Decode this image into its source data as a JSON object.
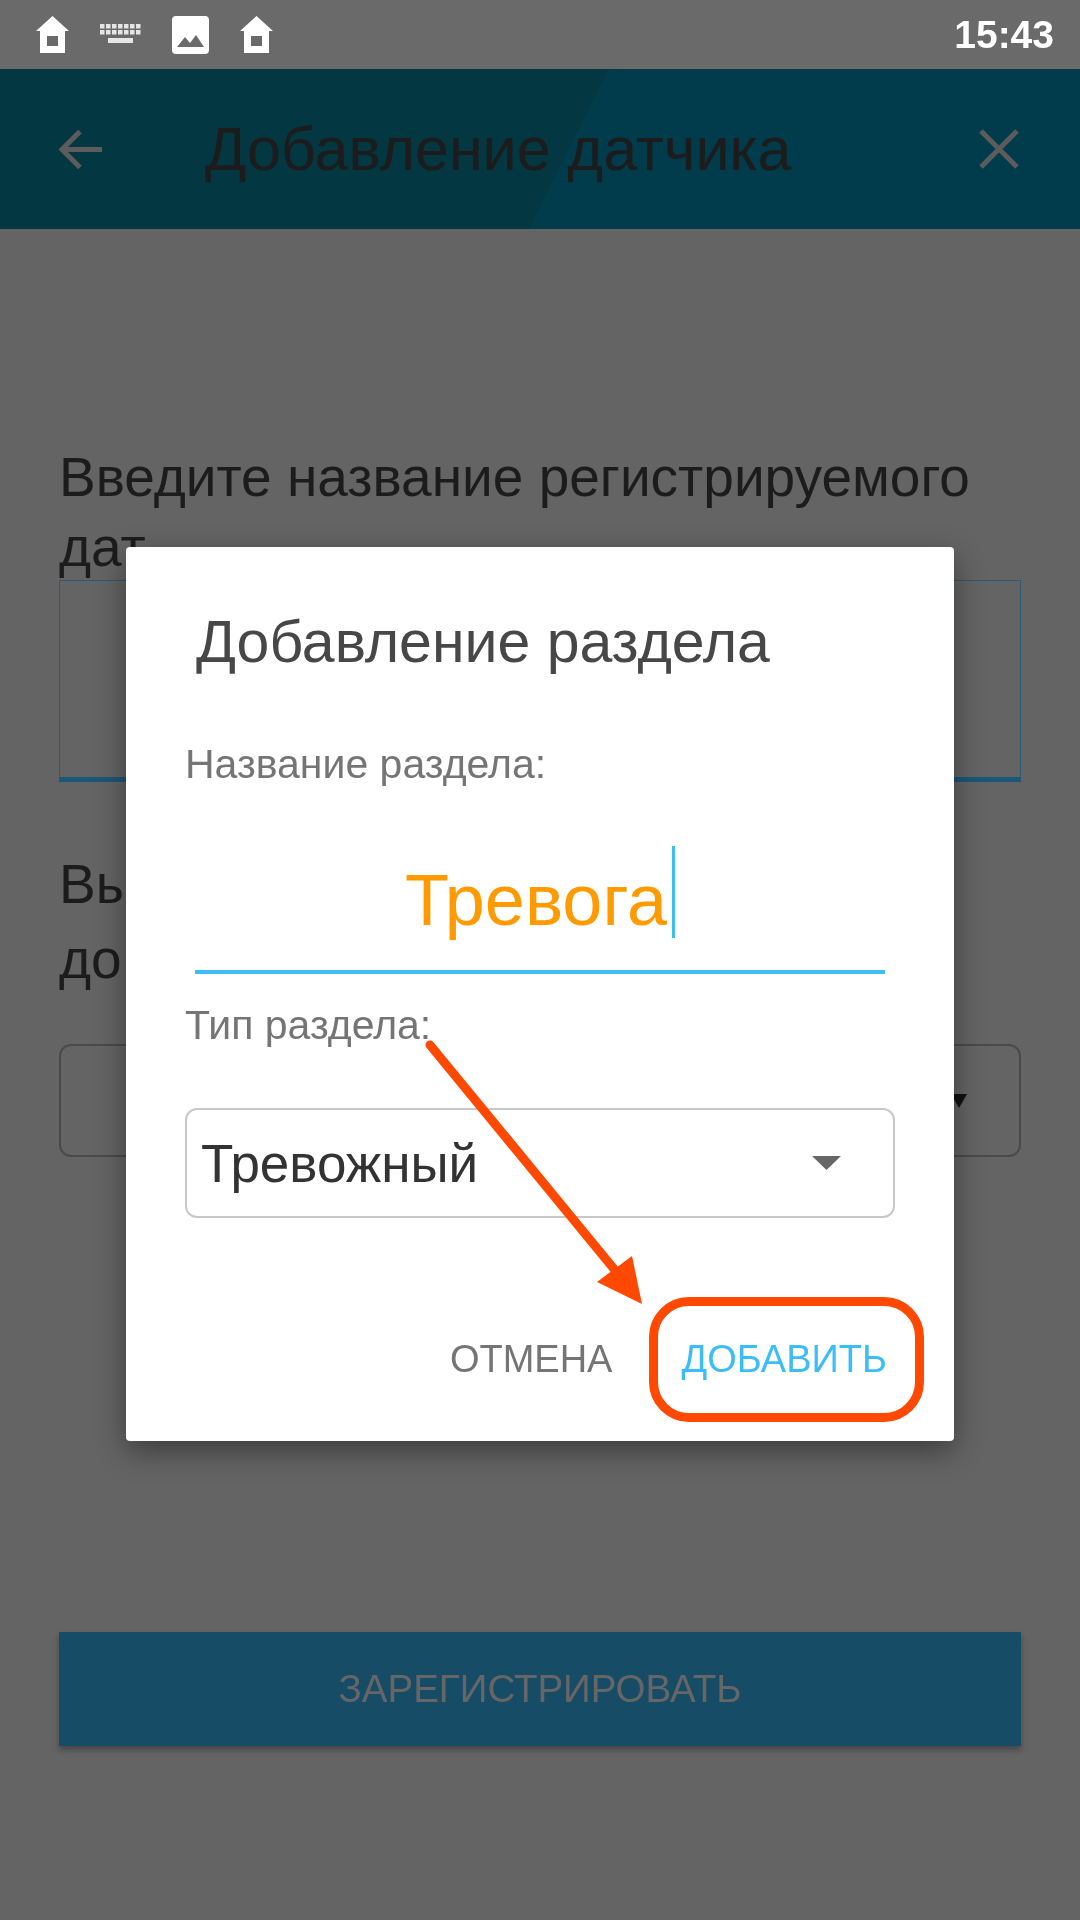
{
  "status_bar": {
    "time": "15:43"
  },
  "app_bar": {
    "title": "Добавление датчика"
  },
  "form": {
    "name_prompt": [
      "Введите название регистрируемого",
      "дат"
    ],
    "section_prompt": [
      "Вы",
      "до"
    ],
    "register_button": "ЗАРЕГИСТРИРОВАТЬ"
  },
  "dialog": {
    "title": "Добавление раздела",
    "name_label": "Название раздела:",
    "name_field": {
      "value": "Тревога",
      "focused": true
    },
    "type_label": "Тип раздела:",
    "type_select": {
      "value": "Тревожный"
    },
    "buttons": [
      {
        "label": "ОТМЕНА",
        "kind": "cancel",
        "highlighted": false
      },
      {
        "label": "ДОБАВИТЬ",
        "kind": "confirm",
        "highlighted": true
      }
    ]
  }
}
